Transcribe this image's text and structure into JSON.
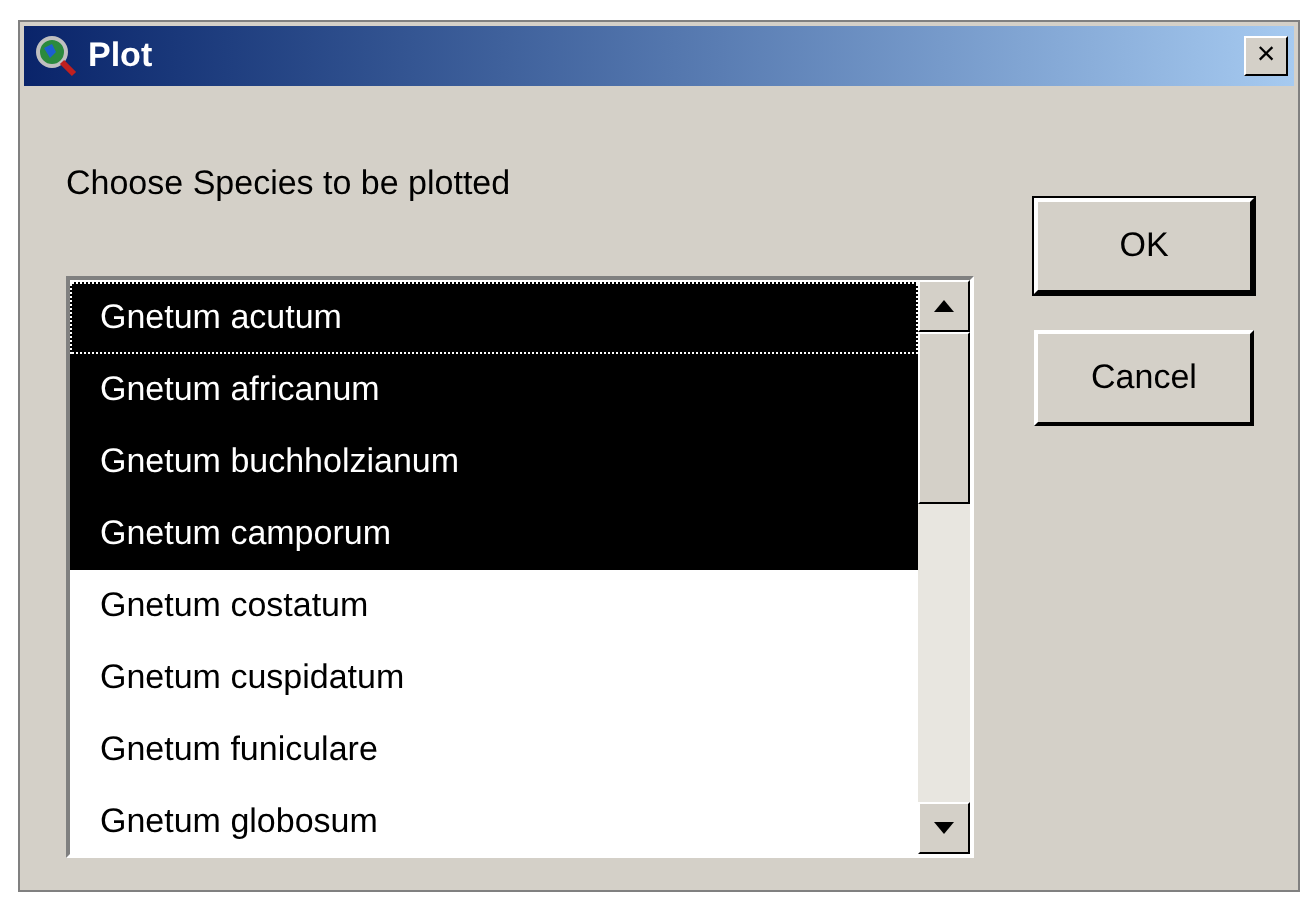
{
  "window": {
    "title": "Plot",
    "close_label": "×"
  },
  "prompt": "Choose Species to be plotted",
  "species": [
    {
      "label": "Gnetum acutum",
      "selected": true,
      "focused": true
    },
    {
      "label": "Gnetum africanum",
      "selected": true,
      "focused": false
    },
    {
      "label": "Gnetum buchholzianum",
      "selected": true,
      "focused": false
    },
    {
      "label": "Gnetum camporum",
      "selected": true,
      "focused": false
    },
    {
      "label": "Gnetum costatum",
      "selected": false,
      "focused": false
    },
    {
      "label": "Gnetum cuspidatum",
      "selected": false,
      "focused": false
    },
    {
      "label": "Gnetum funiculare",
      "selected": false,
      "focused": false
    },
    {
      "label": "Gnetum globosum",
      "selected": false,
      "focused": false
    }
  ],
  "buttons": [
    {
      "label": "OK",
      "default": true
    },
    {
      "label": "Cancel",
      "default": false
    }
  ]
}
